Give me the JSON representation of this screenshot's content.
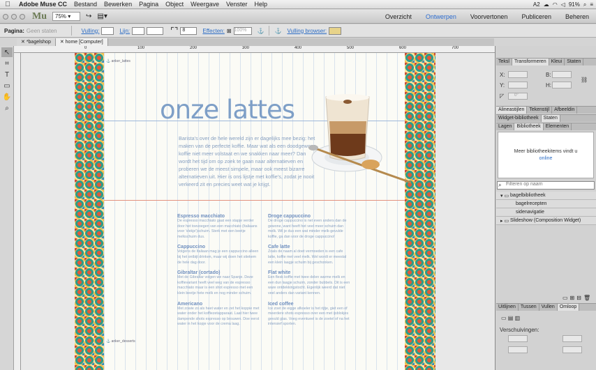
{
  "menubar": {
    "apple": "",
    "app": "Adobe Muse CC",
    "items": [
      "Bestand",
      "Bewerken",
      "Pagina",
      "Object",
      "Weergave",
      "Venster",
      "Help"
    ],
    "status": {
      "battery": "91%",
      "badge": "A2"
    }
  },
  "appbar": {
    "logo": "Mu",
    "zoom": "75%",
    "tabs": [
      "Overzicht",
      "Ontwerpen",
      "Voorvertonen",
      "Publiceren",
      "Beheren"
    ],
    "active_tab": "Ontwerpen"
  },
  "ctrlbar": {
    "page_label": "Pagina:",
    "page_value": "Geen staten",
    "fill": "Vulling:",
    "stroke": "Lijn:",
    "corner_value": "8",
    "effects": "Effecten:",
    "opacity": "100%",
    "browser_fill": "Vulling browser:"
  },
  "doctabs": [
    "*bagelshop",
    "home [Computer]"
  ],
  "ruler": {
    "marks": [
      "0",
      "100",
      "200",
      "300",
      "400",
      "500",
      "600",
      "700",
      "800",
      "900",
      "1000",
      "1100",
      "1200"
    ]
  },
  "page": {
    "anchor_top": "anker_lattes",
    "anchor_bottom": "anker_desserts",
    "title": "onze lattes",
    "intro": "Barista's over de hele wereld zijn er dagelijks mee bezig: het maken van de perfecte koffie. Maar wat als een doodgewone koffie niet meer volstaat en we snakken naar meer? Dan wordt het tijd om op zoek te gaan naar alternatieven en proberen we de meest simpele, maar ook meest bizarre alternatieven uit. Hier is ons lijstje met koffie's, zodat je nooit verkeerd zit en precies weet wat je krijgt.",
    "left_col": [
      {
        "title": "Espresso macchiato",
        "text": "De espresso macchiato gaat een stapje verder door het toevoegen van een macchiato (Italiaans voor 'vlekje')schuim. Sterk met een beetje melkschuim dus."
      },
      {
        "title": "Cappuccino",
        "text": "Volgens de Italiaan mag je een cappuccino alleen bij het ontbijt drinken, maar wij doen het stiekem de hele dag door."
      },
      {
        "title": "Gibraltar (cortado)",
        "text": "Met de Gibraltar volgen we naar Spanje. Deze koffievariant heeft veel weg van de espresso macchiato maar is een shot espresso met een klein beetje hete melk en nog minder schuim."
      },
      {
        "title": "Americano",
        "text": "Met zowie zo als heet water en zet het koppie met water onder het koffiezetapparaat. Laat hier twee dampende shots espresso op brouwen. Doe eerst water in het kopje voor de crema laag."
      }
    ],
    "right_col": [
      {
        "title": "Droge cappuccino",
        "text": "De droge cappuccino is net even anders dan de gewone, want heeft het veel meer schuim dan melk. Wil je dus een wat minder melk-gevulde koffie, ga dan voor de droge cappuccino!"
      },
      {
        "title": "Cafe latte",
        "text": "Zoals de naam al doet vermoeden is een cafe latte, koffie met veel melk. Wel wordt er meestal een klein laagje schuim bij geschonken."
      },
      {
        "title": "Flat white",
        "text": "Een flesk koffie met twee delen warme melk en een dun laagje schuim, zonder bubbels. Dit is een ware ontdekkingstocht. Eigenlijk weerd dat niet veel anders dan variant kennen."
      },
      {
        "title": "Iced coffee",
        "text": "Ice zoet de eigge afkoeler is het rijtje, giet een of meerdere shots espresso over een met ijsblokjes gevuld glas. Voeg eventueel is de zoetel of na het intensief sporten."
      }
    ]
  },
  "rpanel": {
    "tabs1": [
      "Teksl",
      "Transformeren",
      "Kleui",
      "Staten"
    ],
    "labels": {
      "x": "X:",
      "y": "Y:",
      "w": "B:",
      "h": "H:",
      "angle": "0°"
    },
    "tabs2": [
      "Alineastijlen",
      "Tekenstijl",
      "Afbeeldin"
    ],
    "tabs3": [
      "Widget-bibliotheek",
      "Staten"
    ],
    "tabs4": [
      "Lagen",
      "Bibliotheek",
      "Elementen"
    ],
    "lib_msg": "Meer bibliotheekitems vindt u",
    "lib_link": "online",
    "search_placeholder": "Filteren op naam",
    "tree": [
      {
        "label": "bagelbibliotheek",
        "type": "folder"
      },
      {
        "label": "bagelrecepten",
        "type": "sub"
      },
      {
        "label": "sidenavigatie",
        "type": "sub"
      },
      {
        "label": "Slideshow (Composition Widget)",
        "type": "folder"
      }
    ],
    "tabs5": [
      "Uitlijnen",
      "Tussen",
      "Vullen",
      "Omloop"
    ],
    "wrap_label": "Verschuivingen:"
  }
}
